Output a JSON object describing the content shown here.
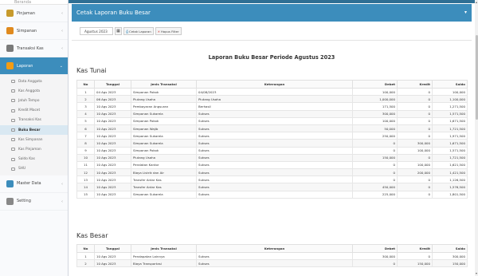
{
  "sidebar": {
    "top_label": "Beranda",
    "menu": [
      {
        "label": "Pinjaman",
        "icon": "handshake-icon",
        "color": "#c79a2c"
      },
      {
        "label": "Simpanan",
        "icon": "wallet-icon",
        "color": "#e08a1e"
      },
      {
        "label": "Transaksi Kas",
        "icon": "exchange-icon",
        "color": "#7a7a7a"
      }
    ],
    "laporan": {
      "label": "Laporan",
      "icon": "report-icon",
      "color": "#f39c12"
    },
    "submenu": [
      {
        "label": "Data Anggota",
        "active": false
      },
      {
        "label": "Kas Anggota",
        "active": false
      },
      {
        "label": "Jatuh Tempo",
        "active": false
      },
      {
        "label": "Kredit Macet",
        "active": false
      },
      {
        "label": "Transaksi Kas",
        "active": false
      },
      {
        "label": "Buku Besar",
        "active": true
      },
      {
        "label": "Kas Simpanan",
        "active": false
      },
      {
        "label": "Kas Pinjaman",
        "active": false
      },
      {
        "label": "Saldo Kas",
        "active": false
      },
      {
        "label": "SHU",
        "active": false
      }
    ],
    "bottom_menu": [
      {
        "label": "Master Data",
        "icon": "database-icon",
        "color": "#3c8dbc"
      },
      {
        "label": "Setting",
        "icon": "wrench-icon",
        "color": "#888888"
      }
    ]
  },
  "header": {
    "title": "Cetak Laporan Buku Besar",
    "caret": "▾"
  },
  "filter": {
    "period_value": "Agustus 2023",
    "calendar_glyph": "▦",
    "print_label": "Cetak Laporan",
    "clear_label": "Hapus Filter"
  },
  "report_title": "Laporan Buku Besar Periode Agustus 2023",
  "columns": {
    "no": "No",
    "tanggal": "Tanggal",
    "jenis": "Jenis Transaksi",
    "keterangan": "Keterangan",
    "debet": "Debet",
    "kredit": "Kredit",
    "saldo": "Saldo"
  },
  "kas_tunai": {
    "title": "Kas Tunai",
    "rows": [
      [
        "1",
        "04 Ags 2023",
        "Simpanan Pokok",
        "04/08/2023",
        "100,000",
        "0",
        "100,000"
      ],
      [
        "2",
        "06 Ags 2023",
        "Piutang Usaha",
        "Piutang Usaha",
        "1,000,000",
        "0",
        "1,100,000"
      ],
      [
        "3",
        "10 Ags 2023",
        "Pembayaran Angsuran",
        "Berhasil",
        "171,500",
        "0",
        "1,271,500"
      ],
      [
        "4",
        "10 Ags 2023",
        "Simpanan Sukarela",
        "Sukses",
        "300,000",
        "0",
        "1,571,500"
      ],
      [
        "5",
        "10 Ags 2023",
        "Simpanan Pokok",
        "Sukses",
        "100,000",
        "0",
        "1,671,500"
      ],
      [
        "6",
        "10 Ags 2023",
        "Simpanan Wajib",
        "Sukses",
        "50,000",
        "0",
        "1,721,500"
      ],
      [
        "7",
        "10 Ags 2023",
        "Simpanan Sukarela",
        "Sukses",
        "250,000",
        "0",
        "1,971,500"
      ],
      [
        "8",
        "10 Ags 2023",
        "Simpanan Sukarela",
        "Sukses",
        "0",
        "300,000",
        "1,671,500"
      ],
      [
        "9",
        "10 Ags 2023",
        "Simpanan Pokok",
        "Sukses",
        "0",
        "100,000",
        "1,571,500"
      ],
      [
        "10",
        "10 Ags 2023",
        "Piutang Usaha",
        "Sukses",
        "150,000",
        "0",
        "1,721,500"
      ],
      [
        "11",
        "10 Ags 2023",
        "Peralatan Kantor",
        "Sukses",
        "0",
        "100,000",
        "1,621,500"
      ],
      [
        "12",
        "10 Ags 2023",
        "Biaya Listrik dan Air",
        "Sukses",
        "0",
        "200,000",
        "1,421,500"
      ],
      [
        "13",
        "10 Ags 2023",
        "Transfer Antar Kas",
        "Sukses",
        "0",
        "0",
        "1,126,500"
      ],
      [
        "14",
        "10 Ags 2023",
        "Transfer Antar Kas",
        "Sukses",
        "450,000",
        "0",
        "1,576,500"
      ],
      [
        "15",
        "10 Ags 2023",
        "Simpanan Sukarela",
        "Sukses",
        "225,000",
        "0",
        "1,801,500"
      ]
    ]
  },
  "kas_besar": {
    "title": "Kas Besar",
    "rows": [
      [
        "1",
        "10 Ags 2023",
        "Pendapatan Lainnya",
        "Sukses",
        "300,000",
        "0",
        "300,000"
      ],
      [
        "2",
        "10 Ags 2023",
        "Biaya Transportasi",
        "Sukses",
        "0",
        "150,000",
        "150,000"
      ]
    ]
  }
}
